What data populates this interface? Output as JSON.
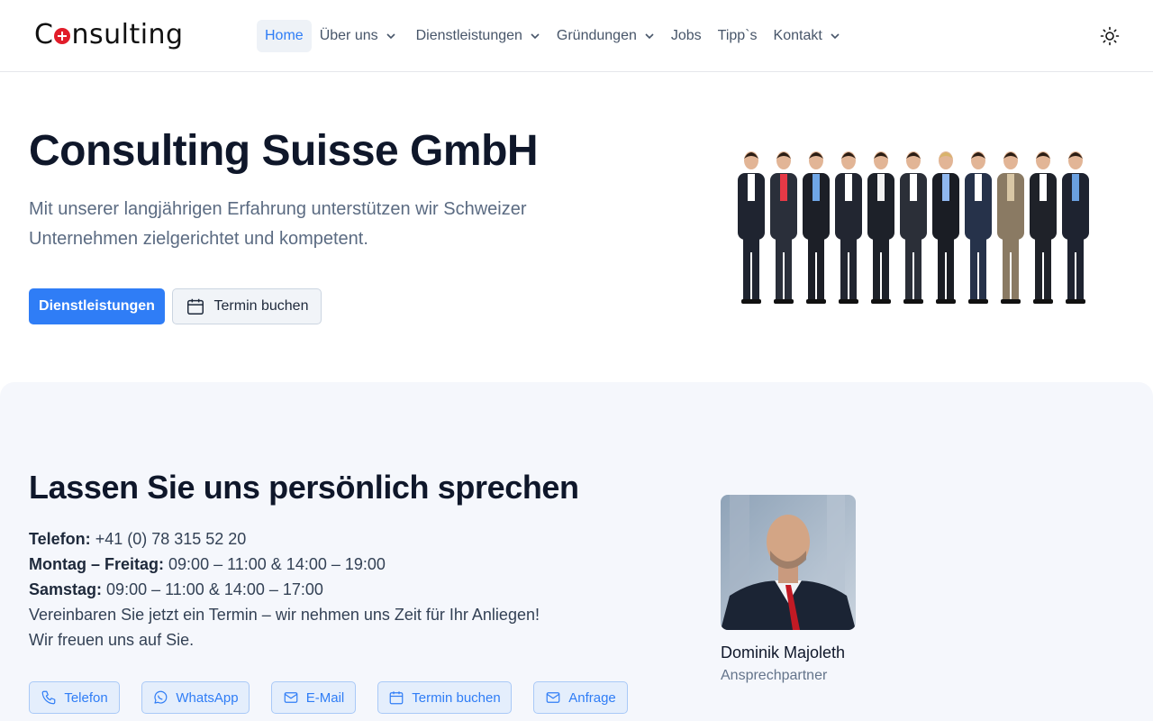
{
  "header": {
    "logo_text": "Consulting",
    "nav": [
      {
        "label": "Home",
        "active": true,
        "dropdown": false
      },
      {
        "label": "Über uns",
        "active": false,
        "dropdown": true
      },
      {
        "label": "Dienstleistungen",
        "active": false,
        "dropdown": true
      },
      {
        "label": "Gründungen",
        "active": false,
        "dropdown": true
      },
      {
        "label": "Jobs",
        "active": false,
        "dropdown": false
      },
      {
        "label": "Tipp`s",
        "active": false,
        "dropdown": false
      },
      {
        "label": "Kontakt",
        "active": false,
        "dropdown": true
      }
    ],
    "theme_icon": "sun-icon"
  },
  "hero": {
    "title": "Consulting Suisse GmbH",
    "subtitle": "Mit unserer langjährigen Erfahrung unterstützen wir Schweizer Unternehmen zielgerichtet und kompetent.",
    "primary_button": "Dienstleistungen",
    "secondary_button": "Termin buchen",
    "image": "group-of-business-people"
  },
  "contact": {
    "title": "Lassen Sie uns persönlich sprechen",
    "phone_label": "Telefon:",
    "phone_value": "+41 (0) 78 315 52 20",
    "weekday_label": "Montag – Freitag:",
    "weekday_value": "09:00 – 11:00 & 14:00 – 19:00",
    "saturday_label": "Samstag:",
    "saturday_value": "09:00 – 11:00 & 14:00 – 17:00",
    "line1": "Vereinbaren Sie jetzt ein Termin – wir nehmen uns Zeit für Ihr Anliegen!",
    "line2": "Wir freuen uns auf Sie.",
    "buttons": {
      "phone": "Telefon",
      "whatsapp": "WhatsApp",
      "email": "E-Mail",
      "booking": "Termin buchen",
      "inquiry": "Anfrage"
    },
    "person_name": "Dominik Majoleth",
    "person_role": "Ansprechpartner"
  },
  "colors": {
    "accent": "#2f7df6",
    "section_bg": "#f5f7fc",
    "logo_red": "#e11d2a"
  }
}
